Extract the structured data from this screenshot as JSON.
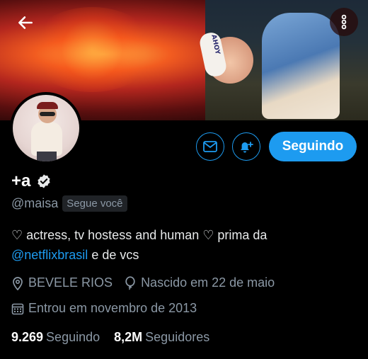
{
  "header": {
    "back_icon": "arrow-left-icon",
    "more_icon": "more-vertical-icon",
    "banner_hat_text": "AHOY"
  },
  "profile": {
    "display_name": "+a",
    "verified_icon": "verified-badge-icon",
    "handle": "@maisa",
    "follows_you_badge": "Segue você",
    "bio_text_1": "♡ actress, tv hostess and human ♡ prima da",
    "bio_mention": "@netflixbrasil",
    "bio_text_2": " e de vcs",
    "location": "BEVELE RIOS",
    "birthday": "Nascido em 22 de maio",
    "joined": "Entrou em novembro de 2013"
  },
  "actions": {
    "message_icon": "mail-icon",
    "notify_icon": "bell-plus-icon",
    "following_label": "Seguindo"
  },
  "stats": {
    "following_count": "9.269",
    "following_label": "Seguindo",
    "followers_count": "8,2M",
    "followers_label": "Seguidores"
  },
  "colors": {
    "accent": "#1d9bf0",
    "muted_text": "#8b98a5",
    "background": "#000000"
  }
}
